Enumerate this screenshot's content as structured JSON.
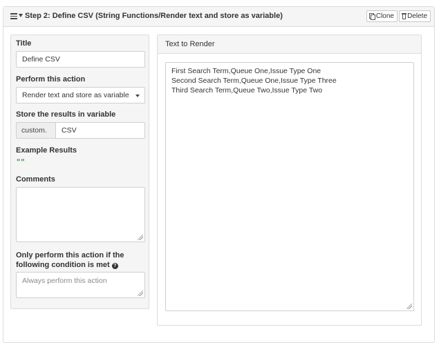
{
  "header": {
    "step_title": "Step 2: Define CSV (String Functions/Render text and store as variable)",
    "clone_label": "Clone",
    "delete_label": "Delete",
    "icons": [
      "hamburger-icon",
      "chevron-down-icon",
      "clone-icon",
      "trash-icon"
    ]
  },
  "form": {
    "title_label": "Title",
    "title_value": "Define CSV",
    "action_label": "Perform this action",
    "action_value": "Render text and store as variable",
    "store_label": "Store the results in variable",
    "variable_prefix": "custom.",
    "variable_value": "CSV",
    "example_label": "Example Results",
    "example_value": "\"\"",
    "comments_label": "Comments",
    "comments_value": "",
    "condition_label": "Only perform this action if the following condition is met",
    "condition_placeholder": "Always perform this action"
  },
  "render": {
    "title": "Text to Render",
    "lines": [
      "First Search Term,Queue One,Issue Type One",
      "Second Search Term,Queue One,Issue Type Three",
      "Third Search Term,Queue Two,Issue Type Two"
    ]
  }
}
